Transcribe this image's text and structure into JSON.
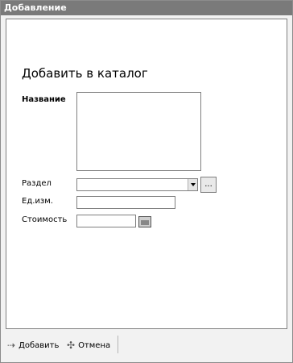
{
  "window": {
    "title": "Добавление"
  },
  "form": {
    "heading": "Добавить в каталог",
    "name_label": "Название",
    "section_label": "Раздел",
    "section_value": "",
    "section_browse": "...",
    "unit_label": "Ед.изм.",
    "unit_value": "",
    "price_label": "Стоимость",
    "price_value": ""
  },
  "toolbar": {
    "add_label": "Добавить",
    "cancel_label": "Отмена"
  }
}
